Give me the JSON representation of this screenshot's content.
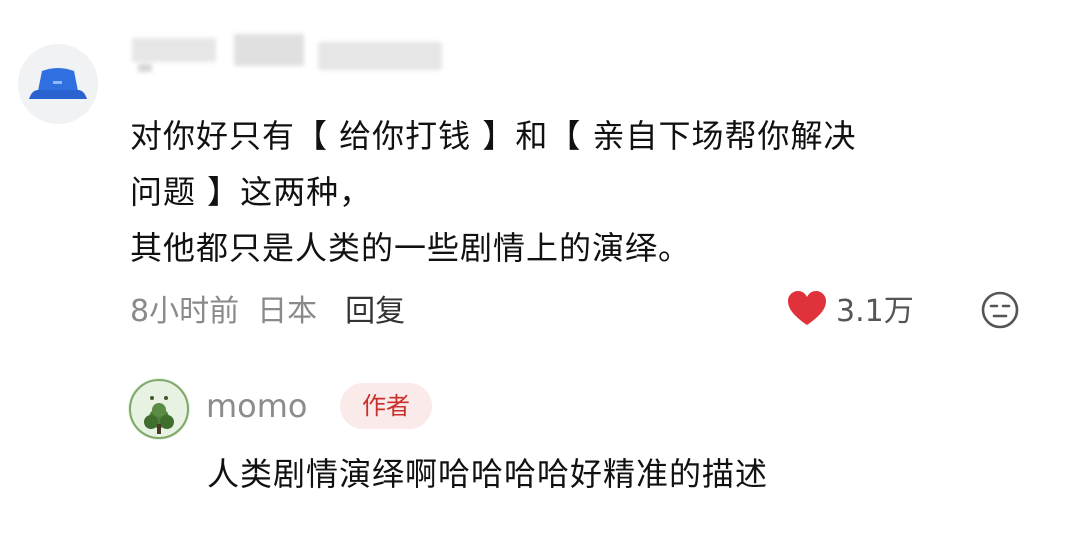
{
  "comment": {
    "avatar_icon": "bucket-hat-icon",
    "username": "",
    "lines": [
      "对你好只有【 给你打钱 】和【 亲自下场帮你解决",
      "问题 】这两种，",
      "其他都只是人类的一些剧情上的演绎。"
    ],
    "time": "8小时前",
    "location": "日本",
    "reply_label": "回复",
    "like_icon": "heart-icon",
    "like_count": "3.1万",
    "like_color": "#e0323a",
    "emoji_icon": "expressionless-face-icon"
  },
  "reply": {
    "avatar_icon": "plant-avatar-icon",
    "username": "momo",
    "badge": "作者",
    "text": "人类剧情演绎啊哈哈哈哈好精准的描述"
  },
  "colors": {
    "badge_bg": "#fbeaea",
    "badge_text": "#c9302c",
    "meta_text": "#8a8a8a",
    "avatar_blue": "#2f6fe0"
  }
}
